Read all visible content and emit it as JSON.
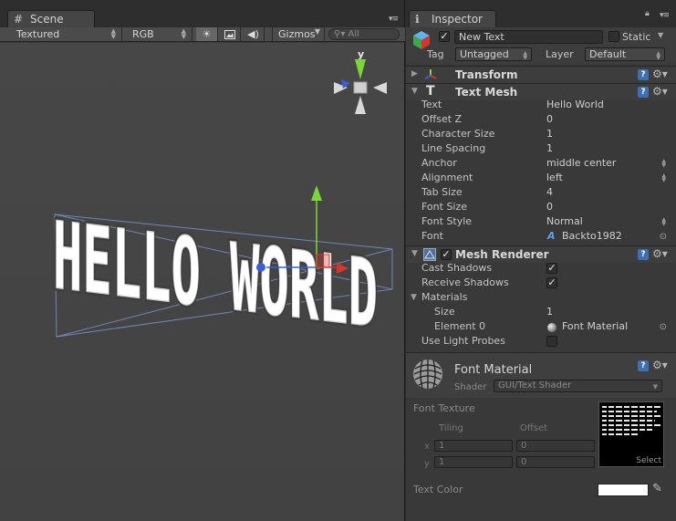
{
  "scene_tab": {
    "label": "Scene",
    "toolbar": {
      "render_mode": "Textured",
      "color_mode": "RGB",
      "gizmos_label": "Gizmos",
      "search_placeholder": "All"
    },
    "axis_label_y": "y",
    "scene_text": "HELLO WORLD"
  },
  "inspector": {
    "tab_label": "Inspector",
    "object": {
      "active": true,
      "name": "New Text",
      "static_label": "Static",
      "static_checked": false,
      "tag_label": "Tag",
      "tag_value": "Untagged",
      "layer_label": "Layer",
      "layer_value": "Default"
    },
    "transform": {
      "title": "Transform"
    },
    "text_mesh": {
      "title": "Text Mesh",
      "fields": [
        {
          "label": "Text",
          "value": "Hello World"
        },
        {
          "label": "Offset Z",
          "value": "0"
        },
        {
          "label": "Character Size",
          "value": "1"
        },
        {
          "label": "Line Spacing",
          "value": "1"
        },
        {
          "label": "Anchor",
          "value": "middle center"
        },
        {
          "label": "Alignment",
          "value": "left"
        },
        {
          "label": "Tab Size",
          "value": "4"
        },
        {
          "label": "Font Size",
          "value": "0"
        },
        {
          "label": "Font Style",
          "value": "Normal"
        },
        {
          "label": "Font",
          "value": "Backto1982"
        }
      ]
    },
    "mesh_renderer": {
      "title": "Mesh Renderer",
      "enabled": true,
      "cast_shadows_label": "Cast Shadows",
      "cast_shadows": true,
      "receive_shadows_label": "Receive Shadows",
      "receive_shadows": true,
      "materials_label": "Materials",
      "size_label": "Size",
      "size_value": "1",
      "element0_label": "Element 0",
      "element0_value": "Font Material",
      "use_light_probes_label": "Use Light Probes",
      "use_light_probes": false
    },
    "material": {
      "name": "Font Material",
      "shader_label": "Shader",
      "shader_value": "GUI/Text Shader",
      "font_texture_label": "Font Texture",
      "tiling_label": "Tiling",
      "offset_label": "Offset",
      "x_label": "x",
      "y_label": "y",
      "tiling_x": "1",
      "tiling_y": "1",
      "offset_x": "0",
      "offset_y": "0",
      "select_label": "Select",
      "text_color_label": "Text Color",
      "text_color": "#ffffff"
    }
  },
  "colors": {
    "gizmo_y": "#7cd63a",
    "gizmo_x": "#d9342b",
    "gizmo_z": "#3a5fd6",
    "accent_blue": "#3e6fb5"
  }
}
